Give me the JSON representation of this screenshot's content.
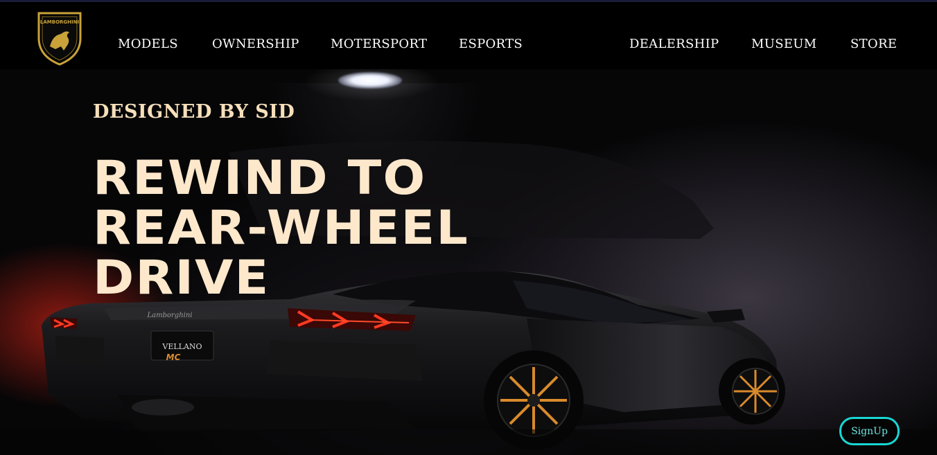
{
  "brand": {
    "logo_text": "LAMBORGHINI"
  },
  "nav": {
    "left": [
      "MODELS",
      "OWNERSHIP",
      "MOTERSPORT",
      "ESPORTS"
    ],
    "right": [
      "DEALERSHIP",
      "MUSEUM",
      "STORE"
    ]
  },
  "hero": {
    "kicker": "DESIGNED BY SID",
    "headline_lines": [
      "REWIND TO",
      "REAR-WHEEL",
      "DRIVE"
    ],
    "plate_text": "VELLANO",
    "badge_text": "Lamborghini"
  },
  "signup": {
    "label": "SignUp"
  },
  "colors": {
    "accent_cyan": "#19d6d3",
    "headline": "#fde8cc",
    "logo_gold": "#c9a23a",
    "taillight": "#ff2a1a",
    "rim_orange": "#d98a2b"
  }
}
